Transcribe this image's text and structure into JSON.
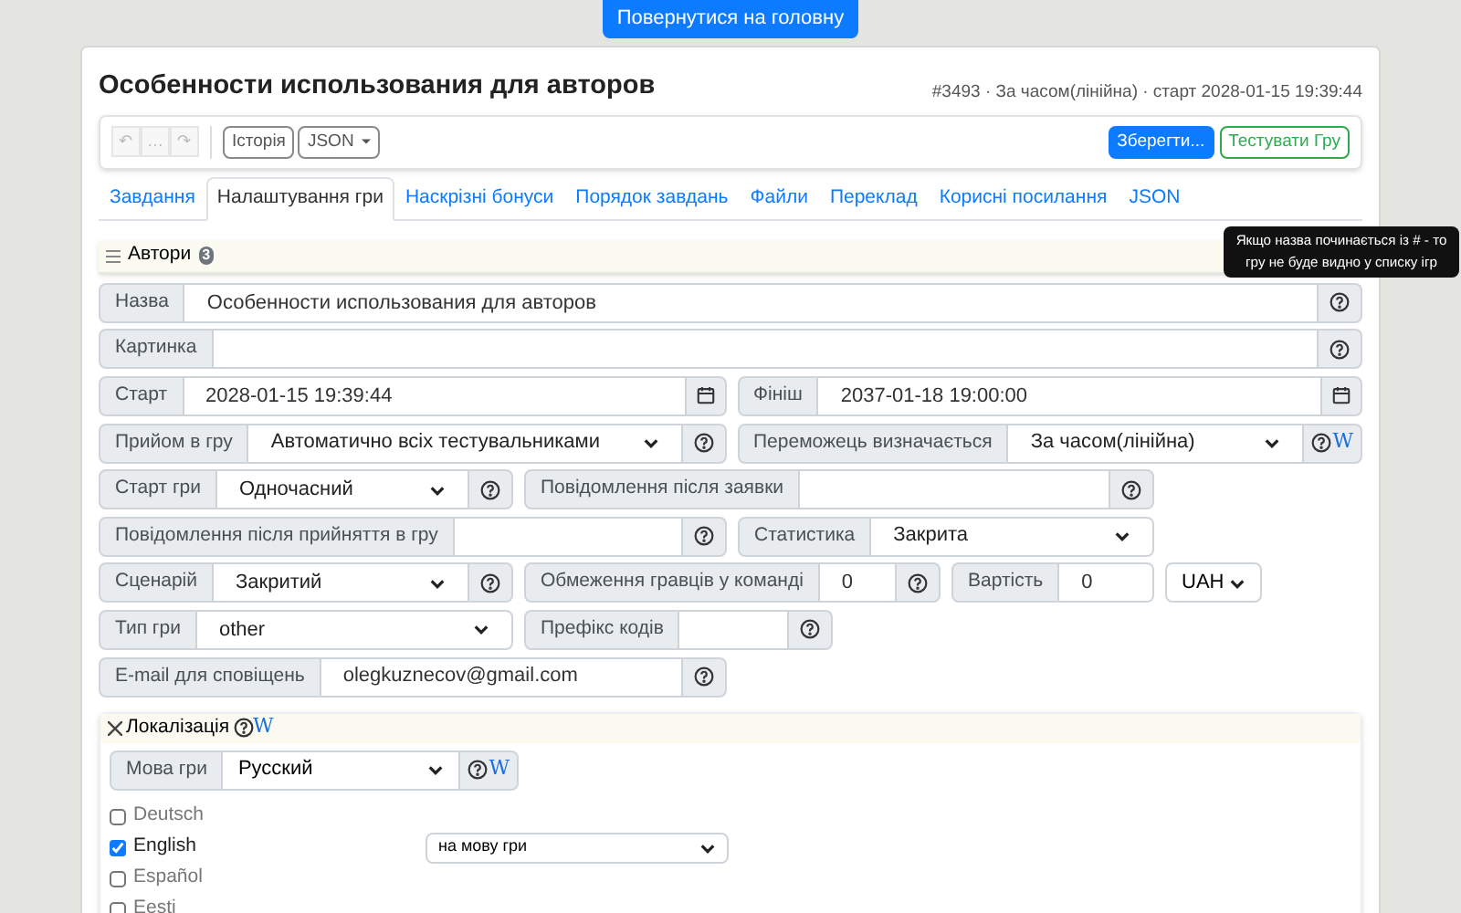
{
  "home_button": "Повернутися на головну",
  "title": "Особенности использования для авторов",
  "meta": "#3493 · За часом(лінійна) · старт 2028-01-15 19:39:44",
  "toolbar": {
    "history_buttons": [
      {
        "label": "↶",
        "disabled": true
      },
      {
        "label": "…",
        "disabled": true
      },
      {
        "label": "↷",
        "disabled": true
      }
    ],
    "history": "Історія",
    "json": "JSON",
    "save": "Зберегти...",
    "test": "Тестувати Гру"
  },
  "tabs": [
    {
      "label": "Завдання",
      "selected": false
    },
    {
      "label": "Налаштування гри",
      "selected": true
    },
    {
      "label": "Наскрізні бонуси",
      "selected": false
    },
    {
      "label": "Порядок завдань",
      "selected": false
    },
    {
      "label": "Файли",
      "selected": false
    },
    {
      "label": "Переклад",
      "selected": false
    },
    {
      "label": "Корисні посилання",
      "selected": false
    },
    {
      "label": "JSON",
      "selected": false
    }
  ],
  "authors": {
    "label": "Автори",
    "count": "3"
  },
  "tooltip": "Якщо назва починається із # - то гру не буде видно у списку ігр",
  "rows": [
    [
      {
        "label": "Назва",
        "kind": "text",
        "value": "Особенности использования для авторов",
        "help": true
      }
    ],
    [
      {
        "label": "Картинка",
        "kind": "text",
        "help": true
      }
    ],
    [
      {
        "label": "Старт",
        "kind": "date",
        "value": "2028-01-15 19:39:44"
      },
      {
        "label": "Фініш",
        "kind": "date",
        "value": "2037-01-18 19:00:00"
      }
    ],
    [
      {
        "label": "Прийом в гру",
        "kind": "select",
        "value": "Автоматично всіх тестувальниками",
        "help": true
      },
      {
        "label": "Переможець визначається",
        "kind": "select",
        "value": "За часом(лінійна)",
        "help": true,
        "wiki": "W"
      }
    ],
    [
      {
        "label": "Старт гри",
        "kind": "select",
        "value": "Одночасний",
        "help": true
      },
      {
        "label": "Повідомлення після заявки",
        "kind": "text",
        "help": true
      }
    ],
    [
      {
        "label": "Повідомлення після прийняття в гру",
        "kind": "text",
        "help": true
      },
      {
        "label": "Статистика",
        "kind": "select",
        "value": "Закрита"
      }
    ],
    [
      {
        "label": "Сценарій",
        "kind": "select",
        "value": "Закритий",
        "help": true
      },
      {
        "label": "Обмеження гравців у команді",
        "kind": "text",
        "value": "0",
        "help": true
      },
      {
        "label": "Вартість",
        "kind": "text",
        "value": "0"
      },
      {
        "kind": "bare_select",
        "value": "UAH"
      }
    ],
    [
      {
        "label": "Тип гри",
        "kind": "select",
        "value": "other"
      },
      {
        "label": "Префікс кодів",
        "kind": "text",
        "help": true
      }
    ],
    [
      {
        "label": "E-mail для сповіщень",
        "kind": "text",
        "value": "olegkuznecov@gmail.com",
        "help": true
      }
    ]
  ],
  "localization": {
    "title": "Локалізація",
    "wiki": "W",
    "language_label": "Мова гри",
    "language": "Русский",
    "language_wiki": "W",
    "languages": [
      {
        "name": "Deutsch",
        "checked": false
      },
      {
        "name": "English",
        "checked": true,
        "mode": "на мову гри"
      },
      {
        "name": "Español",
        "checked": false
      },
      {
        "name": "Eesti",
        "checked": false
      }
    ]
  }
}
